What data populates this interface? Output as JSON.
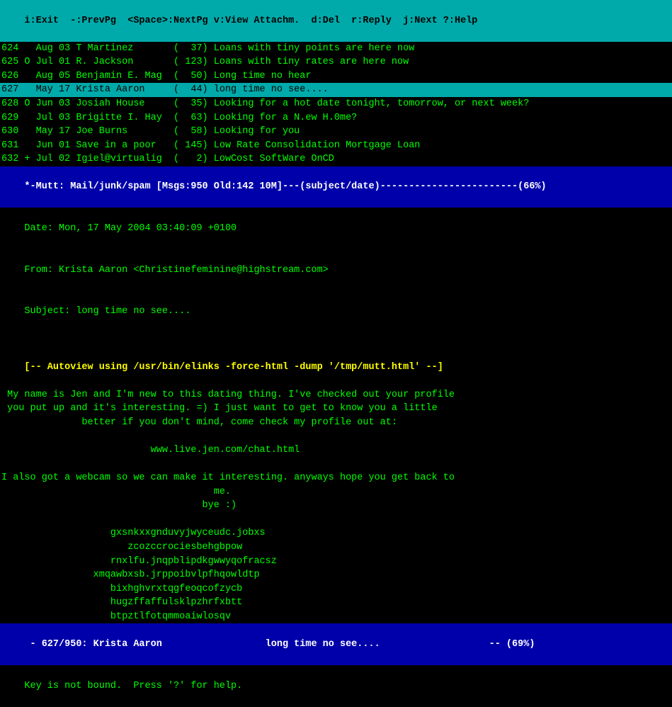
{
  "topbar": {
    "label": "i:Exit  -:PrevPg  <Space>:NextPg v:View Attachm.  d:Del  r:Reply  j:Next ?:Help"
  },
  "mailrows": [
    {
      "num": "624",
      "flag": " ",
      "date": "Aug 03",
      "sender": "T Martinez",
      "size": "  37",
      "subject": "Loans with tiny points are here now",
      "selected": false
    },
    {
      "num": "625",
      "flag": "O",
      "date": "Jul 01",
      "sender": "R. Jackson",
      "size": " 123",
      "subject": "Loans with tiny rates are here now",
      "selected": false
    },
    {
      "num": "626",
      "flag": " ",
      "date": "Aug 05",
      "sender": "Benjamin E. Mag",
      "size": "  50",
      "subject": "Long time no hear",
      "selected": false
    },
    {
      "num": "627",
      "flag": " ",
      "date": "May 17",
      "sender": "Krista Aaron",
      "size": "  44",
      "subject": "long time no see....",
      "selected": true
    },
    {
      "num": "628",
      "flag": "O",
      "date": "Jun 03",
      "sender": "Josiah House",
      "size": "  35",
      "subject": "Looking for a hot date tonight, tomorrow, or next week?",
      "selected": false
    },
    {
      "num": "629",
      "flag": " ",
      "date": "Jul 03",
      "sender": "Brigitte I. Hay",
      "size": "  63",
      "subject": "Looking for a N.ew H.0me?",
      "selected": false
    },
    {
      "num": "630",
      "flag": " ",
      "date": "May 17",
      "sender": "Joe Burns",
      "size": "  58",
      "subject": "Looking for you",
      "selected": false
    },
    {
      "num": "631",
      "flag": " ",
      "date": "Jun 01",
      "sender": "Save in a poor",
      "size": " 145",
      "subject": "Low Rate Consolidation Mortgage Loan",
      "selected": false
    },
    {
      "num": "632",
      "flag": "+",
      "date": "Jul 02",
      "sender": "Igiel@virtualig",
      "size": "   2",
      "subject": "LowCost SoftWare OnCD",
      "selected": false
    }
  ],
  "statusbar": {
    "text": "*-Mutt: Mail/junk/spam [Msgs:950 Old:142 10M]---(subject/date)------------------------(66%)"
  },
  "email": {
    "date": "Date: Mon, 17 May 2004 03:40:09 +0100",
    "from": "From: Krista Aaron <Christinefeminine@highstream.com>",
    "subject": "Subject: long time no see....",
    "autoview": "[-- Autoview using /usr/bin/elinks -force-html -dump '/tmp/mutt.html' --]",
    "body_lines": [
      " My name is Jen and I'm new to this dating thing. I've checked out your profile",
      " you put up and it's interesting. =) I just want to get to know you a little",
      "              better if you don't mind, come check my profile out at:",
      "",
      "                          www.live.jen.com/chat.html",
      "",
      "I also got a webcam so we can make it interesting. anyways hope you get back to",
      "                                     me.",
      "                                   bye :)",
      "",
      "                   gxsnkxxgnduvyjwyceudc.jobxs",
      "                      zcozccrociesbehgbpow",
      "                   rnxlfu.jnqpblipdkgwwyqofracsz",
      "                xmqawbxsb.jrppoibvlpfhqowldtp",
      "                   bixhghvrxtqgfeoqcofzycb",
      "                   hugzffaffulsklpzhrfxbtt",
      "                   btpztlfotqmmoaiwlosqv"
    ]
  },
  "bottomstatus": {
    "text": " - 627/950: Krista Aaron                  long time no see....                   -- (69%)"
  },
  "bottominfo": {
    "text": "Key is not bound.  Press '?' for help."
  }
}
